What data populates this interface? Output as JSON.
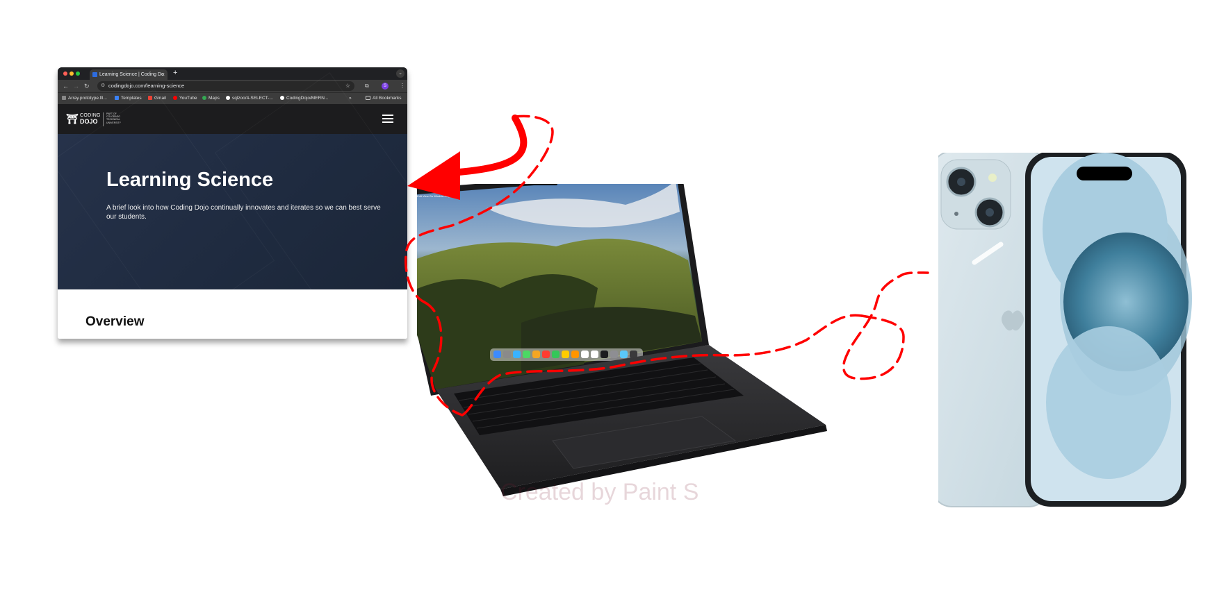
{
  "browser": {
    "tab_title": "Learning Science | Coding Do",
    "tab_close": "×",
    "new_tab": "+",
    "url": "codingdojo.com/learning-science",
    "profile_initial": "S",
    "bookmarks": [
      {
        "label": "Array.prototype.fil...",
        "icon": "mdn-icon",
        "color": "#cccccc"
      },
      {
        "label": "Templates",
        "icon": "templates-icon",
        "color": "#3b82f6"
      },
      {
        "label": "Gmail",
        "icon": "gmail-icon",
        "color": "#ea4335"
      },
      {
        "label": "YouTube",
        "icon": "youtube-icon",
        "color": "#ff0000"
      },
      {
        "label": "Maps",
        "icon": "maps-icon",
        "color": "#34a853"
      },
      {
        "label": "sqlzoo/4-SELECT-...",
        "icon": "github-icon",
        "color": "#ffffff"
      },
      {
        "label": "CodingDojo/MERN...",
        "icon": "github-icon",
        "color": "#ffffff"
      }
    ],
    "more_bookmarks": "»",
    "all_bookmarks": "All Bookmarks"
  },
  "site": {
    "logo_line1": "CODING",
    "logo_line2": "DOJO",
    "logo_partof": "PART OF\nCOLORADO\nTECHNICAL\nUNIVERSITY",
    "hero_title": "Learning Science",
    "hero_subtitle": "A brief look into how Coding Dojo continually innovates and iterates so we can best serve our students.",
    "section_heading": "Overview"
  },
  "laptop": {
    "menu_items": [
      "Finder",
      "File",
      "Edit",
      "View",
      "Go",
      "Window",
      "Help"
    ],
    "dock_colors": [
      "#3d8bff",
      "#8a8a8a",
      "#39b3ff",
      "#4cd964",
      "#f5a623",
      "#ff3b30",
      "#34c759",
      "#ffcc00",
      "#ff9500",
      "#ffffff",
      "#ffffff",
      "#1c1c1e",
      "#8e8e93",
      "#5ac8fa",
      "#3a3a3c"
    ]
  },
  "watermark": "Created by Paint S",
  "colors": {
    "annotation": "#ff0000",
    "hero_bg": "#1f2b40",
    "nav_bg": "#1c1c1e"
  }
}
